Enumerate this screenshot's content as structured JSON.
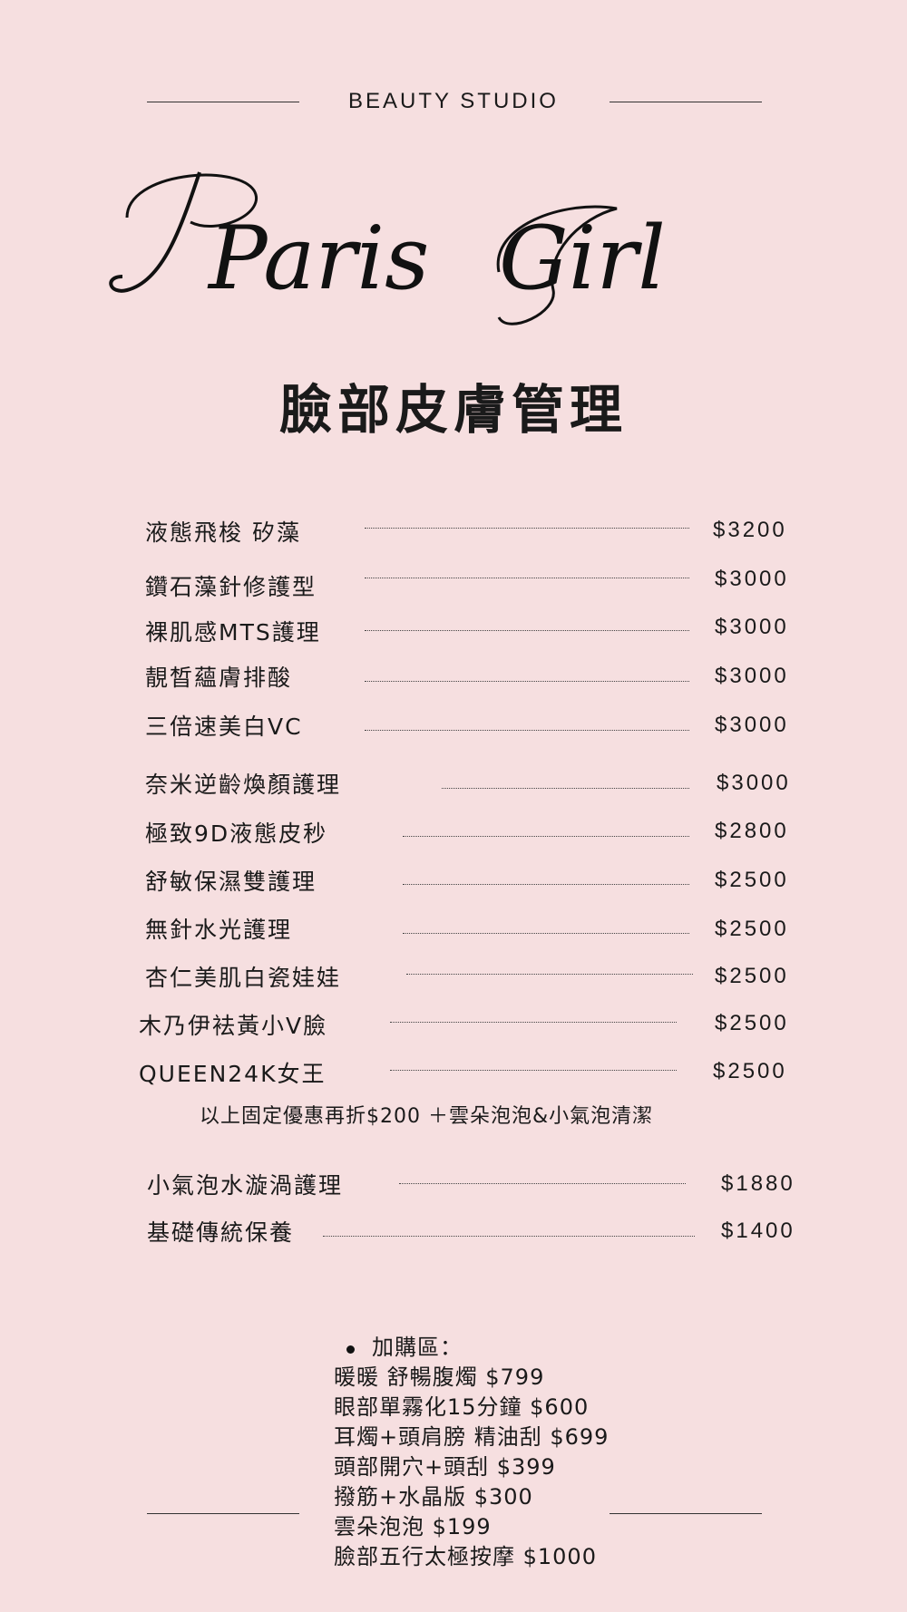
{
  "header": {
    "studio": "BEAUTY STUDIO",
    "brand_first": "Paris",
    "brand_second": "Girl"
  },
  "title": "臉部皮膚管理",
  "menu": [
    {
      "name": "液態飛梭 矽藻",
      "price": "$3200"
    },
    {
      "name": "鑽石藻針修護型",
      "price": "$3000"
    },
    {
      "name": "裸肌感MTS護理",
      "price": "$3000"
    },
    {
      "name": "靚晳蘊膚排酸",
      "price": "$3000"
    },
    {
      "name": "三倍速美白VC",
      "price": "$3000"
    },
    {
      "name": "奈米逆齡煥顏護理",
      "price": "$3000"
    },
    {
      "name": "極致9D液態皮秒",
      "price": "$2800"
    },
    {
      "name": "舒敏保濕雙護理",
      "price": "$2500"
    },
    {
      "name": "無針水光護理",
      "price": "$2500"
    },
    {
      "name": "杏仁美肌白瓷娃娃",
      "price": "$2500"
    },
    {
      "name": "木乃伊袪黃小V臉",
      "price": "$2500"
    },
    {
      "name": "QUEEN24K女王",
      "price": "$2500"
    }
  ],
  "promo_note": "以上固定優惠再折$200 ＋雲朵泡泡&小氣泡清潔",
  "menu_extra": [
    {
      "name": "小氣泡水漩渦護理",
      "price": "$1880"
    },
    {
      "name": "基礎傳統保養",
      "price": "$1400"
    }
  ],
  "addons": {
    "title": "加購區：",
    "items": [
      "暖暖 舒暢腹燭 $799",
      "眼部單霧化15分鐘 $600",
      "耳燭+頭肩膀 精油刮 $699",
      "頭部開穴+頭刮 $399",
      "撥筋+水晶版 $300",
      "雲朵泡泡 $199",
      "臉部五行太極按摩 $1000"
    ]
  }
}
